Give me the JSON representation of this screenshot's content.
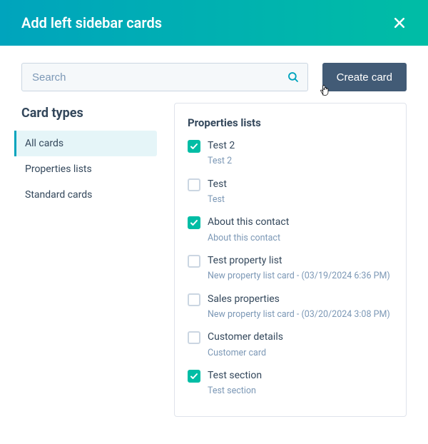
{
  "header": {
    "title": "Add left sidebar cards"
  },
  "search": {
    "placeholder": "Search"
  },
  "create_button": "Create card",
  "sidebar": {
    "heading": "Card types",
    "items": [
      {
        "label": "All cards",
        "active": true
      },
      {
        "label": "Properties lists",
        "active": false
      },
      {
        "label": "Standard cards",
        "active": false
      }
    ]
  },
  "panel": {
    "heading": "Properties lists",
    "cards": [
      {
        "title": "Test 2",
        "sub": "Test 2",
        "checked": true
      },
      {
        "title": "Test",
        "sub": "Test",
        "checked": false
      },
      {
        "title": "About this contact",
        "sub": "About this contact",
        "checked": true
      },
      {
        "title": "Test property list",
        "sub": "New property list card - (03/19/2024 6:36 PM)",
        "checked": false
      },
      {
        "title": "Sales properties",
        "sub": "New property list card - (03/20/2024 3:08 PM)",
        "checked": false
      },
      {
        "title": "Customer details",
        "sub": "Customer card",
        "checked": false
      },
      {
        "title": "Test section",
        "sub": "Test section",
        "checked": true
      }
    ]
  }
}
